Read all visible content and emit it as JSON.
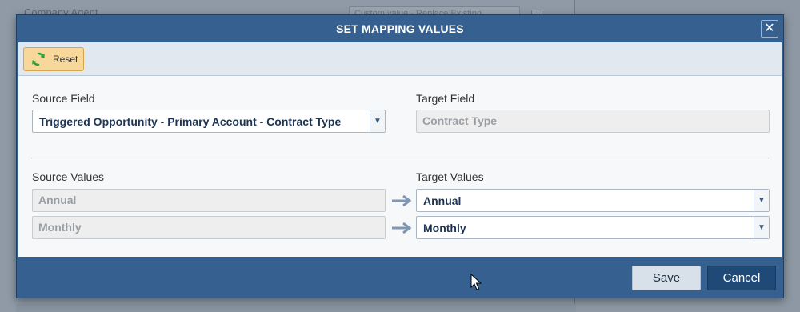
{
  "background": {
    "label": "Company Agent",
    "input_text": "Custom value - Replace Existing"
  },
  "dialog": {
    "title": "SET MAPPING VALUES",
    "close_glyph": "✕",
    "toolbar": {
      "reset_label": "Reset",
      "reset_icon": "refresh-icon"
    },
    "source_field": {
      "label": "Source Field",
      "value": "Triggered Opportunity - Primary Account - Contract Type"
    },
    "target_field": {
      "label": "Target Field",
      "value": "Contract Type"
    },
    "source_values_label": "Source Values",
    "target_values_label": "Target Values",
    "mappings": [
      {
        "source": "Annual",
        "target": "Annual"
      },
      {
        "source": "Monthly",
        "target": "Monthly"
      }
    ],
    "footer": {
      "save_label": "Save",
      "cancel_label": "Cancel"
    },
    "colors": {
      "header": "#35608f",
      "reset_button": "#f7d79a",
      "cancel_button": "#1f4a77"
    }
  }
}
